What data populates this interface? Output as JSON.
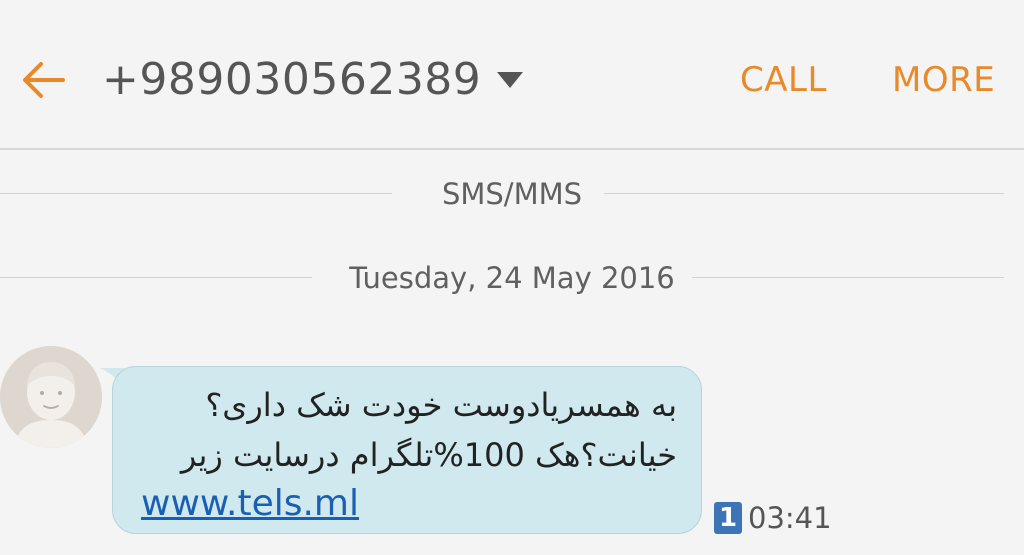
{
  "header": {
    "contact": "+989030562389",
    "call_label": "CALL",
    "more_label": "MORE",
    "back_icon": "arrow-back-icon",
    "dropdown_icon": "caret-down-icon"
  },
  "thread": {
    "channel_label": "SMS/MMS",
    "date_label": "Tuesday, 24 May 2016"
  },
  "message": {
    "line1": "به همسریادوست خودت شک داری؟",
    "line2": "خیانت؟هک 100%تلگرام درسایت زیر",
    "link": "www.tels.ml",
    "sim_slot": "1",
    "time": "03:41",
    "avatar_icon": "default-contact-avatar-icon"
  },
  "colors": {
    "accent": "#e8892a",
    "bubble": "#cfe9ef",
    "link": "#1a5fb4",
    "sim_badge": "#3d74b6",
    "background": "#f4f4f4"
  }
}
